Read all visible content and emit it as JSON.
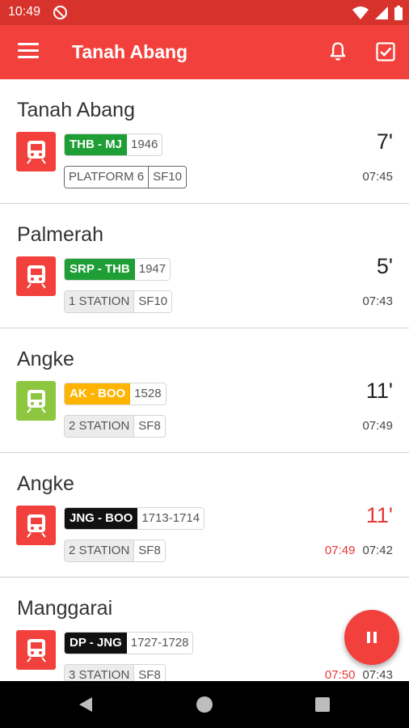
{
  "status_bar": {
    "time": "10:49"
  },
  "app_bar": {
    "title": "Tanah Abang",
    "menu_icon": "menu-icon",
    "bell_icon": "bell-icon",
    "check_icon": "checkbox-icon"
  },
  "colors": {
    "primary": "#f2413c",
    "status_bar": "#d8322c",
    "late": "#e53935",
    "green_route": "#1e9e34",
    "yellow_route": "#ffb400",
    "black_route": "#111111",
    "lime_train": "#8dc63f"
  },
  "trains": [
    {
      "station": "Tanah Abang",
      "icon_color": "#f2413c",
      "route": "THB - MJ",
      "route_color": "#1e9e34",
      "number": "1946",
      "info_left": "PLATFORM 6",
      "info_right": "SF10",
      "platform": true,
      "minutes": "7'",
      "late": false,
      "delay_time": "",
      "time": "07:45"
    },
    {
      "station": "Palmerah",
      "icon_color": "#f2413c",
      "route": "SRP - THB",
      "route_color": "#1e9e34",
      "number": "1947",
      "info_left": "1 STATION",
      "info_right": "SF10",
      "platform": false,
      "minutes": "5'",
      "late": false,
      "delay_time": "",
      "time": "07:43"
    },
    {
      "station": "Angke",
      "icon_color": "#8dc63f",
      "route": "AK - BOO",
      "route_color": "#ffb400",
      "number": "1528",
      "info_left": "2 STATION",
      "info_right": "SF8",
      "platform": false,
      "minutes": "11'",
      "late": false,
      "delay_time": "",
      "time": "07:49"
    },
    {
      "station": "Angke",
      "icon_color": "#f2413c",
      "route": "JNG - BOO",
      "route_color": "#111111",
      "number": "1713-1714",
      "info_left": "2 STATION",
      "info_right": "SF8",
      "platform": false,
      "minutes": "11'",
      "late": true,
      "delay_time": "07:49",
      "time": "07:42"
    },
    {
      "station": "Manggarai",
      "icon_color": "#f2413c",
      "route": "DP - JNG",
      "route_color": "#111111",
      "number": "1727-1728",
      "info_left": "3 STATION",
      "info_right": "SF8",
      "platform": false,
      "minutes": "",
      "late": true,
      "delay_time": "07:50",
      "time": "07:43"
    }
  ],
  "fab": {
    "icon": "pause-icon"
  },
  "nav_bar": {
    "back_icon": "back-icon",
    "home_icon": "home-icon",
    "recents_icon": "recents-icon"
  }
}
